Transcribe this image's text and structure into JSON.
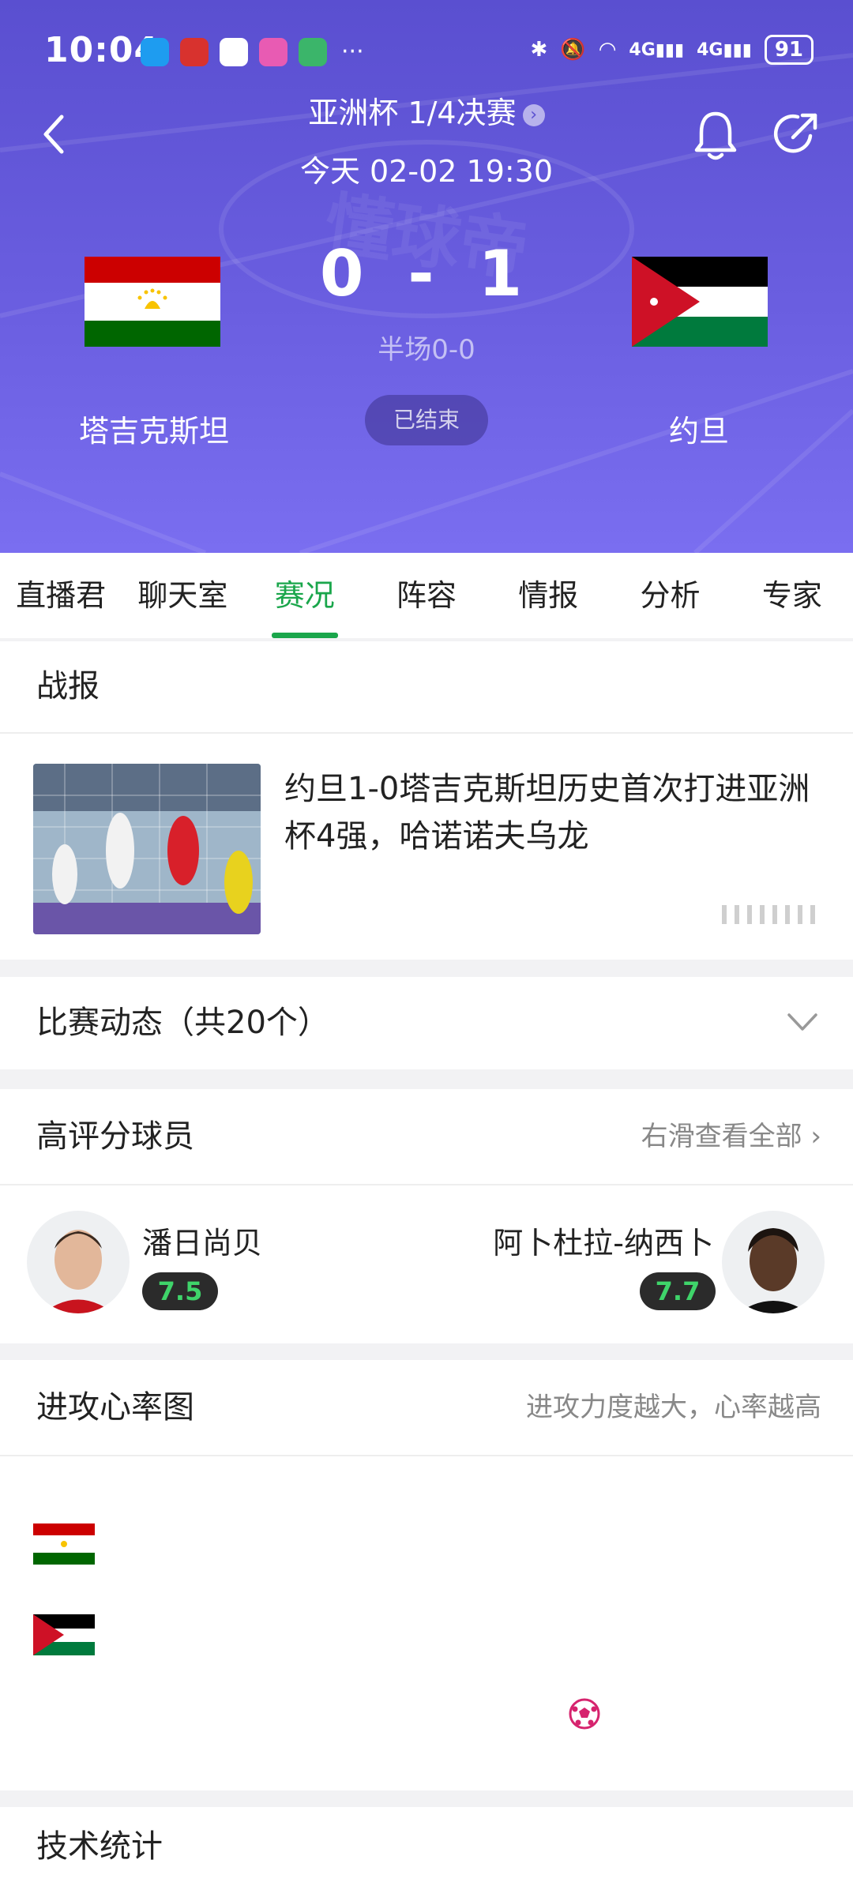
{
  "status_bar": {
    "time": "10:04",
    "more": "···",
    "signal_1": "4G",
    "signal_2": "4G",
    "battery": "91"
  },
  "match": {
    "title": "亚洲杯 1/4决赛",
    "datetime": "今天 02-02 19:30",
    "home_team": "塔吉克斯坦",
    "away_team": "约旦",
    "score": "0 - 1",
    "halftime": "半场0-0",
    "status": "已结束"
  },
  "tabs": [
    {
      "label": "直播君",
      "active": false
    },
    {
      "label": "聊天室",
      "active": false
    },
    {
      "label": "赛况",
      "active": true
    },
    {
      "label": "阵容",
      "active": false
    },
    {
      "label": "情报",
      "active": false
    },
    {
      "label": "分析",
      "active": false
    },
    {
      "label": "专家",
      "active": false
    }
  ],
  "report": {
    "heading": "战报",
    "news_title": "约旦1-0塔吉克斯坦历史首次打进亚洲杯4强，哈诺诺夫乌龙"
  },
  "events": {
    "heading": "比赛动态（共20个）"
  },
  "top_players": {
    "heading": "高评分球员",
    "see_all": "右滑查看全部",
    "home": {
      "name": "潘日尚贝",
      "rating": "7.5"
    },
    "away": {
      "name": "阿卜杜拉-纳西卜",
      "rating": "7.7"
    }
  },
  "attack_chart": {
    "heading": "进攻心率图",
    "note": "进攻力度越大，心率越高"
  },
  "stats": {
    "heading": "技术统计"
  },
  "colors": {
    "header_purple": "#6a5ee0",
    "accent_green": "#1aa64b",
    "rating_green": "#3fd46a"
  }
}
